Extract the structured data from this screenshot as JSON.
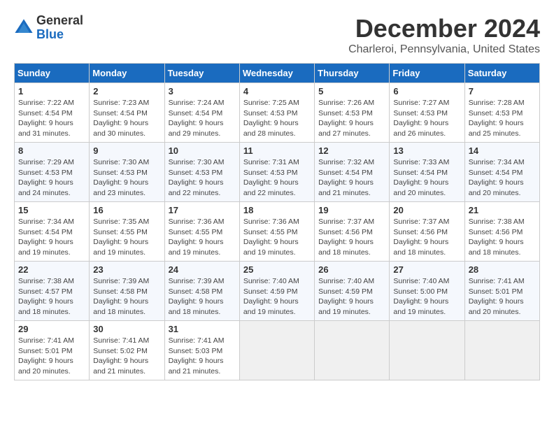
{
  "logo": {
    "general": "General",
    "blue": "Blue"
  },
  "title": "December 2024",
  "location": "Charleroi, Pennsylvania, United States",
  "weekdays": [
    "Sunday",
    "Monday",
    "Tuesday",
    "Wednesday",
    "Thursday",
    "Friday",
    "Saturday"
  ],
  "weeks": [
    [
      {
        "day": "1",
        "sunrise": "7:22 AM",
        "sunset": "4:54 PM",
        "daylight": "9 hours and 31 minutes."
      },
      {
        "day": "2",
        "sunrise": "7:23 AM",
        "sunset": "4:54 PM",
        "daylight": "9 hours and 30 minutes."
      },
      {
        "day": "3",
        "sunrise": "7:24 AM",
        "sunset": "4:54 PM",
        "daylight": "9 hours and 29 minutes."
      },
      {
        "day": "4",
        "sunrise": "7:25 AM",
        "sunset": "4:53 PM",
        "daylight": "9 hours and 28 minutes."
      },
      {
        "day": "5",
        "sunrise": "7:26 AM",
        "sunset": "4:53 PM",
        "daylight": "9 hours and 27 minutes."
      },
      {
        "day": "6",
        "sunrise": "7:27 AM",
        "sunset": "4:53 PM",
        "daylight": "9 hours and 26 minutes."
      },
      {
        "day": "7",
        "sunrise": "7:28 AM",
        "sunset": "4:53 PM",
        "daylight": "9 hours and 25 minutes."
      }
    ],
    [
      {
        "day": "8",
        "sunrise": "7:29 AM",
        "sunset": "4:53 PM",
        "daylight": "9 hours and 24 minutes."
      },
      {
        "day": "9",
        "sunrise": "7:30 AM",
        "sunset": "4:53 PM",
        "daylight": "9 hours and 23 minutes."
      },
      {
        "day": "10",
        "sunrise": "7:30 AM",
        "sunset": "4:53 PM",
        "daylight": "9 hours and 22 minutes."
      },
      {
        "day": "11",
        "sunrise": "7:31 AM",
        "sunset": "4:53 PM",
        "daylight": "9 hours and 22 minutes."
      },
      {
        "day": "12",
        "sunrise": "7:32 AM",
        "sunset": "4:54 PM",
        "daylight": "9 hours and 21 minutes."
      },
      {
        "day": "13",
        "sunrise": "7:33 AM",
        "sunset": "4:54 PM",
        "daylight": "9 hours and 20 minutes."
      },
      {
        "day": "14",
        "sunrise": "7:34 AM",
        "sunset": "4:54 PM",
        "daylight": "9 hours and 20 minutes."
      }
    ],
    [
      {
        "day": "15",
        "sunrise": "7:34 AM",
        "sunset": "4:54 PM",
        "daylight": "9 hours and 19 minutes."
      },
      {
        "day": "16",
        "sunrise": "7:35 AM",
        "sunset": "4:55 PM",
        "daylight": "9 hours and 19 minutes."
      },
      {
        "day": "17",
        "sunrise": "7:36 AM",
        "sunset": "4:55 PM",
        "daylight": "9 hours and 19 minutes."
      },
      {
        "day": "18",
        "sunrise": "7:36 AM",
        "sunset": "4:55 PM",
        "daylight": "9 hours and 19 minutes."
      },
      {
        "day": "19",
        "sunrise": "7:37 AM",
        "sunset": "4:56 PM",
        "daylight": "9 hours and 18 minutes."
      },
      {
        "day": "20",
        "sunrise": "7:37 AM",
        "sunset": "4:56 PM",
        "daylight": "9 hours and 18 minutes."
      },
      {
        "day": "21",
        "sunrise": "7:38 AM",
        "sunset": "4:56 PM",
        "daylight": "9 hours and 18 minutes."
      }
    ],
    [
      {
        "day": "22",
        "sunrise": "7:38 AM",
        "sunset": "4:57 PM",
        "daylight": "9 hours and 18 minutes."
      },
      {
        "day": "23",
        "sunrise": "7:39 AM",
        "sunset": "4:58 PM",
        "daylight": "9 hours and 18 minutes."
      },
      {
        "day": "24",
        "sunrise": "7:39 AM",
        "sunset": "4:58 PM",
        "daylight": "9 hours and 18 minutes."
      },
      {
        "day": "25",
        "sunrise": "7:40 AM",
        "sunset": "4:59 PM",
        "daylight": "9 hours and 19 minutes."
      },
      {
        "day": "26",
        "sunrise": "7:40 AM",
        "sunset": "4:59 PM",
        "daylight": "9 hours and 19 minutes."
      },
      {
        "day": "27",
        "sunrise": "7:40 AM",
        "sunset": "5:00 PM",
        "daylight": "9 hours and 19 minutes."
      },
      {
        "day": "28",
        "sunrise": "7:41 AM",
        "sunset": "5:01 PM",
        "daylight": "9 hours and 20 minutes."
      }
    ],
    [
      {
        "day": "29",
        "sunrise": "7:41 AM",
        "sunset": "5:01 PM",
        "daylight": "9 hours and 20 minutes."
      },
      {
        "day": "30",
        "sunrise": "7:41 AM",
        "sunset": "5:02 PM",
        "daylight": "9 hours and 21 minutes."
      },
      {
        "day": "31",
        "sunrise": "7:41 AM",
        "sunset": "5:03 PM",
        "daylight": "9 hours and 21 minutes."
      },
      null,
      null,
      null,
      null
    ]
  ]
}
